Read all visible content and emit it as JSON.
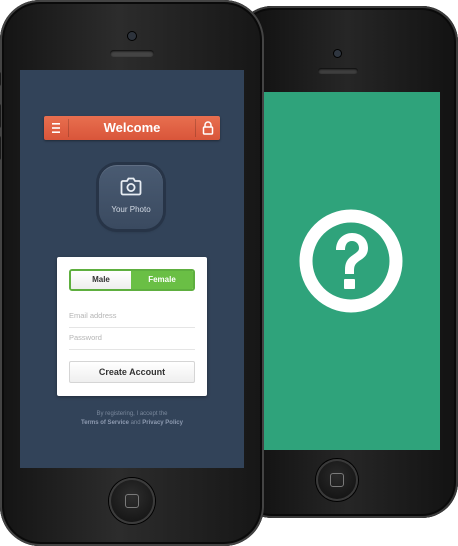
{
  "back_phone": {
    "screen_color": "#2fa37b",
    "icon": "question-circle-icon"
  },
  "front_phone": {
    "screen_color": "#324359",
    "header": {
      "title": "Welcome",
      "accent_color": "#e0603f",
      "left_icon": "menu-icon",
      "right_icon": "lock-icon"
    },
    "photo": {
      "label": "Your Photo",
      "icon": "camera-icon"
    },
    "form": {
      "gender_options": [
        "Male",
        "Female"
      ],
      "selected_gender": "Female",
      "selected_color": "#6abf45",
      "email_placeholder": "Email address",
      "password_placeholder": "Password",
      "submit_label": "Create Account"
    },
    "legal": {
      "prefix": "By registering, I accept the",
      "terms": "Terms of Service",
      "conjunction": "and",
      "privacy": "Privacy Policy"
    }
  }
}
